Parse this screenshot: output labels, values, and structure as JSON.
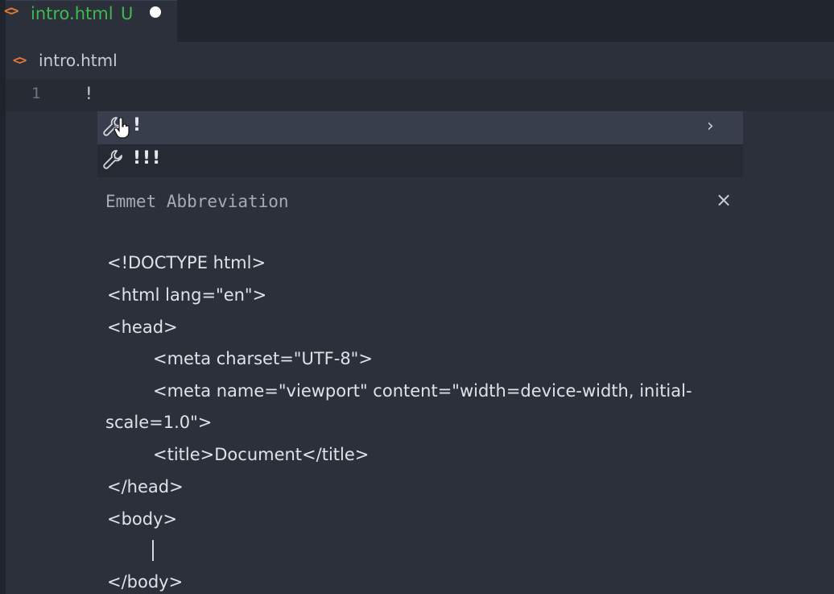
{
  "tab": {
    "icon": "html-file-icon",
    "name": "intro.html",
    "status": "U",
    "modified": true
  },
  "breadcrumb": {
    "icon": "html-file-icon",
    "label": "intro.html"
  },
  "editor": {
    "line_number": "1",
    "line_text": "!"
  },
  "suggest": {
    "items": [
      {
        "icon": "wrench-icon",
        "label": "!",
        "selected": true
      },
      {
        "icon": "wrench-icon",
        "label": "!!!",
        "selected": false
      }
    ],
    "expand_icon": "chevron-right-icon",
    "details_title": "Emmet Abbreviation",
    "close_icon": "close-icon",
    "preview_lines": [
      "<!DOCTYPE html>",
      "<html lang=\"en\">",
      "<head>",
      "<meta charset=\"UTF-8\">",
      "<meta name=\"viewport\" content=\"width=device-width, initial-",
      "scale=1.0\">",
      "<title>Document</title>",
      "</head>",
      "<body>",
      "</body>"
    ]
  },
  "colors": {
    "background": "#2b303b",
    "file_icon": "#e37933",
    "untracked_green": "#3fb950",
    "selected_item": "#383e4c"
  }
}
